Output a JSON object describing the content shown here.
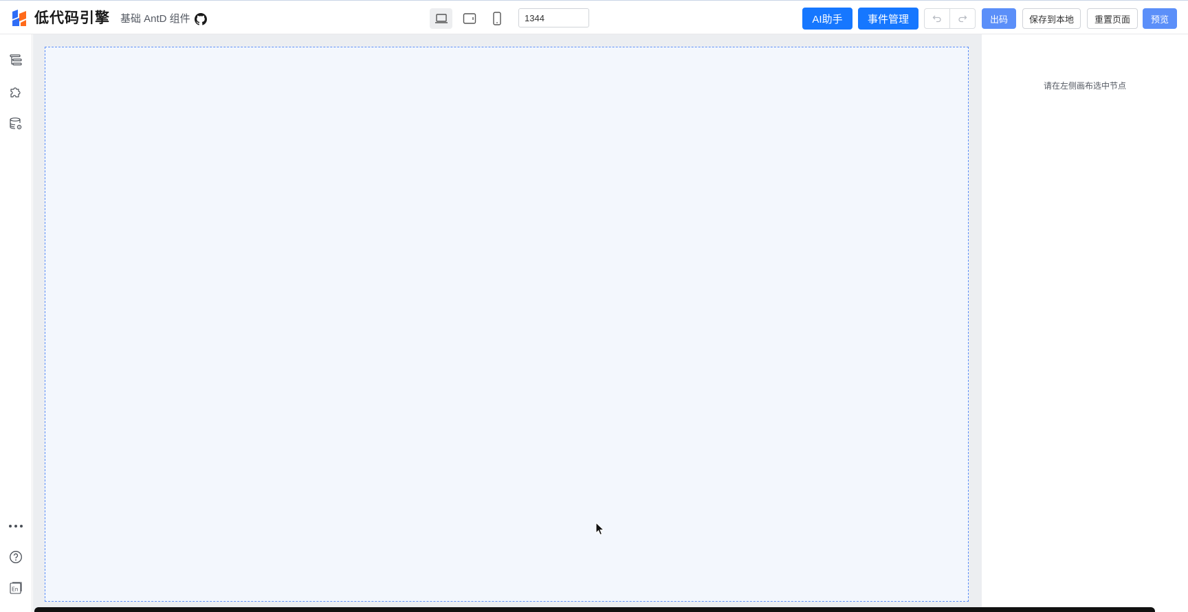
{
  "header": {
    "app_name": "低代码引擎",
    "component_lib": "基础 AntD 组件",
    "devices": {
      "desktop": "laptop-icon",
      "tablet": "tablet-icon",
      "mobile": "phone-icon",
      "active": "desktop"
    },
    "width_value": "1344",
    "width_unit": "px",
    "ai_assistant_label": "AI助手",
    "event_manager_label": "事件管理",
    "undo_icon": "undo-icon",
    "redo_icon": "redo-icon",
    "export_code_label": "出码",
    "save_local_label": "保存到本地",
    "reset_page_label": "重置页面",
    "preview_label": "预览"
  },
  "left_rail": {
    "top_icons": [
      "outline-tree-icon",
      "component-puzzle-icon",
      "datasource-icon"
    ],
    "bottom_icons": [
      "more-icon",
      "help-icon",
      "language-en-icon"
    ],
    "language_glyph": "En"
  },
  "right_panel": {
    "empty_hint": "请在左侧画布选中节点"
  },
  "colors": {
    "primary": "#1677ff",
    "primary_light": "#5b8ff9",
    "canvas_bg": "#f3f7fd",
    "canvas_border": "#5b8ff9",
    "workspace_bg": "#eceef1"
  }
}
